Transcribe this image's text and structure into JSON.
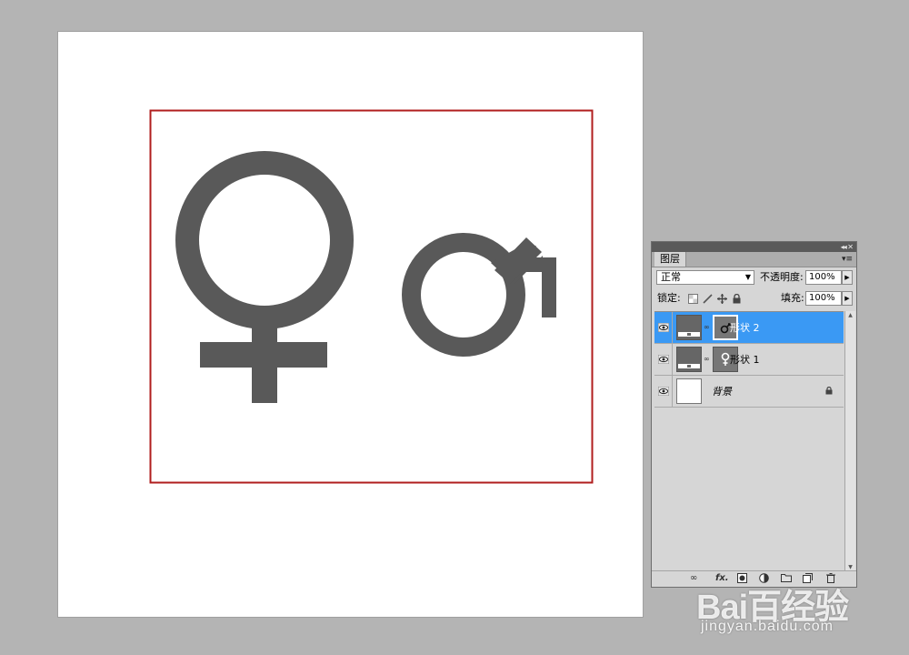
{
  "panel": {
    "tab_label": "图层",
    "blend_mode": "正常",
    "opacity_label": "不透明度:",
    "opacity_value": "100%",
    "lock_label": "锁定:",
    "fill_label": "填充:",
    "fill_value": "100%",
    "layers": [
      {
        "name": "形状 2",
        "selected": true,
        "thumb": "vector-shape-thumbnail",
        "mask": "male-symbol-mask"
      },
      {
        "name": "形状 1",
        "selected": false,
        "thumb": "vector-shape-thumbnail",
        "mask": "female-symbol-mask"
      },
      {
        "name": "背景",
        "selected": false,
        "thumb": "white-thumbnail",
        "locked": true
      }
    ],
    "bottom_icons": [
      "link-icon",
      "fx-icon",
      "mask-icon",
      "adjustment-icon",
      "group-icon",
      "new-layer-icon",
      "trash-icon"
    ],
    "bottom_labels": {
      "fx": "fx."
    }
  },
  "canvas": {
    "shapes": [
      "female-symbol",
      "male-symbol"
    ],
    "shape_color": "#595959",
    "frame_color": "#b01e1e"
  },
  "watermark": {
    "logo": "Bai百经验",
    "url": "jingyan.baidu.com"
  },
  "colors": {
    "selection": "#3a99f4",
    "workspace": "#b4b4b4"
  }
}
